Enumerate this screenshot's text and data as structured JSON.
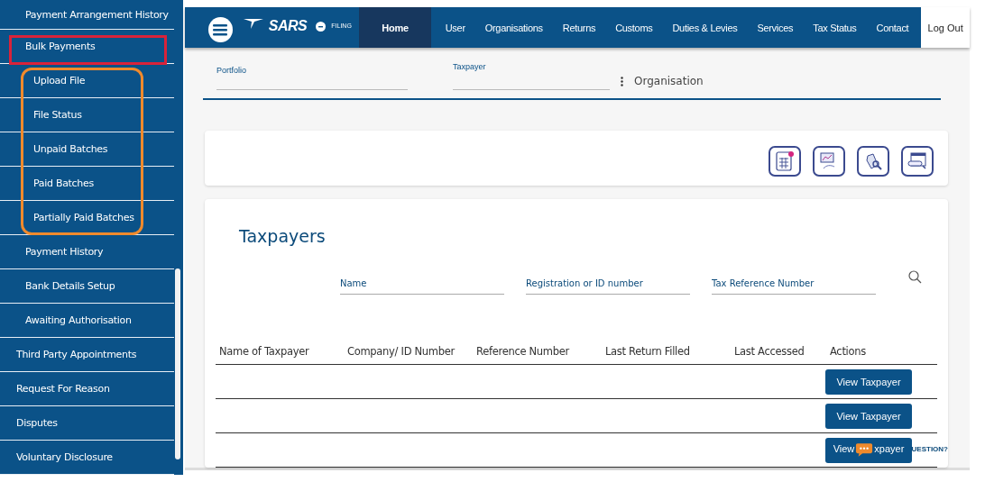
{
  "sidebar": {
    "section_items": [
      {
        "label": "Payment Arrangement History",
        "highlighted": false,
        "group_outlined": false
      },
      {
        "label": "Bulk Payments",
        "highlighted": true,
        "group_outlined": true,
        "children": [
          {
            "label": "Upload File"
          },
          {
            "label": "File Status"
          },
          {
            "label": "Unpaid Batches"
          },
          {
            "label": "Paid Batches"
          },
          {
            "label": "Partially Paid Batches"
          }
        ]
      },
      {
        "label": "Payment History",
        "highlighted": false,
        "group_outlined": false
      },
      {
        "label": "Bank Details Setup",
        "highlighted": false,
        "group_outlined": false
      },
      {
        "label": "Awaiting Authorisation",
        "highlighted": false,
        "group_outlined": false
      }
    ],
    "items": [
      {
        "label": "Third Party Appointments"
      },
      {
        "label": "Request For Reason"
      },
      {
        "label": "Disputes"
      },
      {
        "label": "Voluntary Disclosure"
      }
    ]
  },
  "navbar": {
    "brand": "SARS",
    "brand_suffix": "FILING",
    "items": [
      {
        "label": "Home",
        "selected": true
      },
      {
        "label": "User",
        "selected": false
      },
      {
        "label": "Organisations",
        "selected": false
      },
      {
        "label": "Returns",
        "selected": false
      },
      {
        "label": "Customs",
        "selected": false
      },
      {
        "label": "Duties & Levies",
        "selected": false
      },
      {
        "label": "Services",
        "selected": false
      },
      {
        "label": "Tax Status",
        "selected": false
      },
      {
        "label": "Contact",
        "selected": false
      }
    ],
    "logout": "Log Out"
  },
  "filters": {
    "portfolio_label": "Portfolio",
    "taxpayer_label": "Taxpayer",
    "type": "Organisation"
  },
  "taxpayers": {
    "title": "Taxpayers",
    "search_fields": [
      {
        "placeholder": "Name"
      },
      {
        "placeholder": "Registration or ID number"
      },
      {
        "placeholder": "Tax Reference Number"
      }
    ],
    "columns": [
      "Name of Taxpayer",
      "Company/ ID Number",
      "Reference Number",
      "Last Return Filled",
      "Last Accessed",
      "Actions"
    ],
    "rows": [
      {
        "action": "View Taxpayer"
      },
      {
        "action": "View Taxpayer"
      },
      {
        "action": "View",
        "action_after_icon": "xpayer"
      }
    ]
  },
  "chat": {
    "label": "UESTION?"
  }
}
